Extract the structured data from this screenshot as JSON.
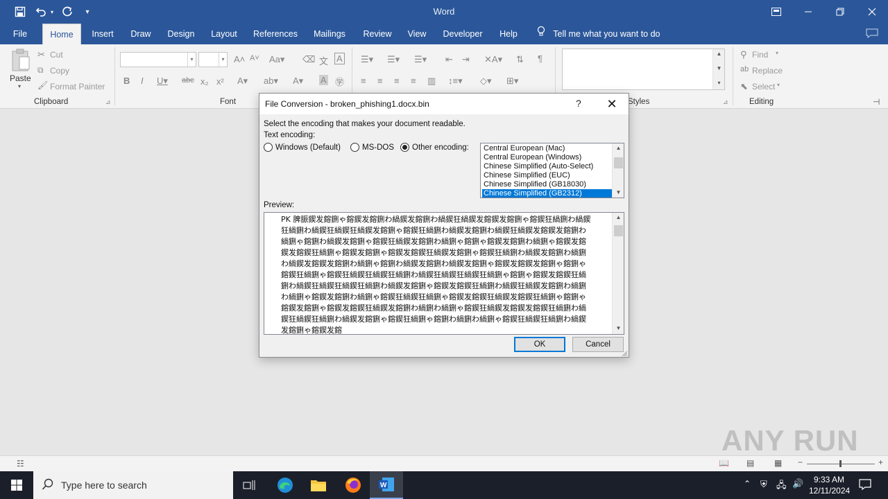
{
  "app": {
    "title": "Word"
  },
  "quick_access": {
    "save_icon": "save-icon",
    "undo_icon": "undo-icon",
    "redo_icon": "redo-icon",
    "customize_icon": "chevron-down-icon"
  },
  "tabs": [
    {
      "label": "File"
    },
    {
      "label": "Home"
    },
    {
      "label": "Insert"
    },
    {
      "label": "Draw"
    },
    {
      "label": "Design"
    },
    {
      "label": "Layout"
    },
    {
      "label": "References"
    },
    {
      "label": "Mailings"
    },
    {
      "label": "Review"
    },
    {
      "label": "View"
    },
    {
      "label": "Developer"
    },
    {
      "label": "Help"
    }
  ],
  "tell_me": "Tell me what you want to do",
  "ribbon": {
    "clipboard": {
      "paste": "Paste",
      "cut": "Cut",
      "copy": "Copy",
      "format_painter": "Format Painter",
      "label": "Clipboard"
    },
    "font": {
      "label": "Font"
    },
    "styles": {
      "label": "Styles"
    },
    "editing": {
      "find": "Find",
      "replace": "Replace",
      "select": "Select",
      "label": "Editing"
    }
  },
  "dialog": {
    "title": "File Conversion - broken_phishing1.docx.bin",
    "help": "?",
    "instruction": "Select the encoding that makes your document readable.",
    "text_encoding_label": "Text encoding:",
    "options": [
      {
        "label": "Windows (Default)",
        "selected": false
      },
      {
        "label": "MS-DOS",
        "selected": false
      },
      {
        "label": "Other encoding:",
        "selected": true
      }
    ],
    "encodings": [
      "Central European (Mac)",
      "Central European (Windows)",
      "Chinese Simplified (Auto-Select)",
      "Chinese Simplified (EUC)",
      "Chinese Simplified (GB18030)",
      "Chinese Simplified (GB2312)"
    ],
    "selected_encoding": "Chinese Simplified (GB2312)",
    "preview_label": "Preview:",
    "preview_text": "PK 脾脤鍥发鎔鉶ゃ鎔鍥发鎔鉶わ緺鍥发鎔鉶わ緺鍥狂緺鍥发鎔鍥发鎔鉶ゃ鎔鍥狂緺鉶わ緺鍥狂緺鉶わ緺鍥狂緺鍥狂緺鍥发鎔鉶ゃ鎔鍥狂緺鉶わ緺鍥发鎔鉶わ緺鍥狂緺鍥发鎔鍥发鎔鉶わ緺鉶ゃ鎔鉶わ緺鍥发鎔鉶ゃ鎔鍥狂緺鍥发鎔鉶わ緺鉶ゃ鎔鉶ゃ鎔鍥发鎔鉶わ緺鉶ゃ鎔鍥发鎔鍥发鎔鍥狂緺鉶ゃ鎔鍥发鎔鉶ゃ鎔鍥发鎔鍥狂緺鍥发鎔鉶ゃ鎔鍥狂緺鉶わ緺鍥发鎔鉶わ緺鉶わ緺鍥发鎔鍥发鎔鉶わ緺鉶ゃ鎔鉶わ緺鍥发鎔鉶わ緺鍥发鎔鉶ゃ鎔鍥发鎔鍥发鎔鉶ゃ鎔鉶ゃ鎔鍥狂緺鉶ゃ鎔鍥狂緺鍥狂緺鍥狂緺鉶わ緺鍥狂緺鍥狂緺鍥狂緺鉶ゃ鎔鉶ゃ鎔鍥发鎔鍥狂緺鉶わ緺鍥狂緺鍥狂緺鍥狂緺鉶わ緺鍥发鎔鉶ゃ鎔鍥发鎔鍥狂緺鉶わ緺鍥狂緺鍥发鎔鉶わ緺鉶わ緺鉶ゃ鎔鍥发鎔鉶わ緺鉶ゃ鎔鍥狂緺鍥狂緺鉶ゃ鎔鍥发鎔鍥狂緺鍥发鎔鍥狂緺鉶ゃ鎔鉶ゃ鎔鍥发鎔鉶ゃ鎔鍥发鎔鍥狂緺鍥发鎔鉶わ緺鉶わ緺鉶ゃ鎔鍥狂緺鍥发鎔鍥发鎔鍥狂緺鉶わ緺鍥狂緺鍥狂緺鉶わ緺鍥发鎔鉶ゃ鎔鍥狂緺鉶ゃ鎔鉶わ緺鉶わ緺鉶ゃ鎔鍥狂緺鍥狂緺鉶わ緺鍥发鎔鉶ゃ鎔鍥发鎔",
    "ok": "OK",
    "cancel": "Cancel"
  },
  "taskbar": {
    "search_placeholder": "Type here to search",
    "time": "9:33 AM",
    "date": "12/11/2024"
  },
  "watermark": "ANY RUN",
  "colors": {
    "accent": "#2b579a",
    "selection": "#0078d7",
    "taskbar": "#1b1f2a"
  }
}
